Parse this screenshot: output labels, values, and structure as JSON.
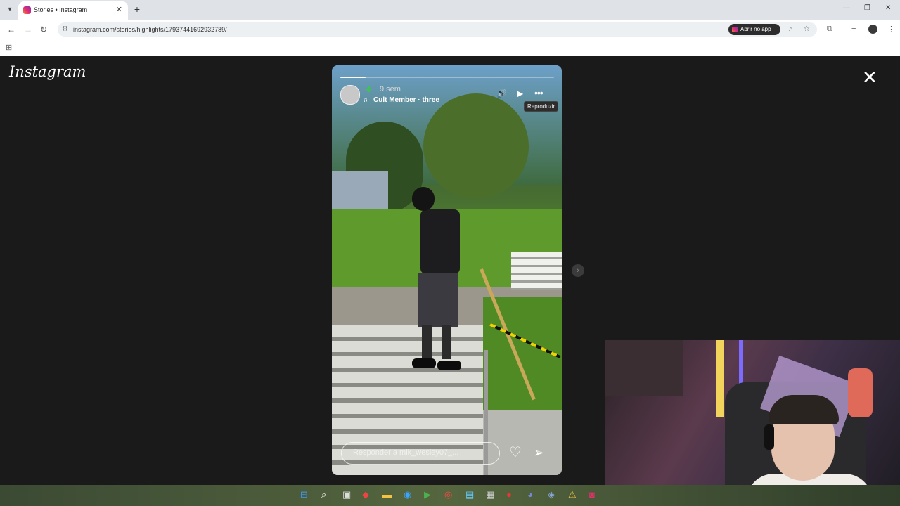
{
  "browser": {
    "tab_title": "Stories • Instagram",
    "tab_close": "✕",
    "new_tab": "+",
    "url": "instagram.com/stories/highlights/17937441692932789/",
    "open_app_label": "Abrir no app",
    "window_controls": {
      "minimize": "—",
      "restore": "❐",
      "close": "✕"
    }
  },
  "instagram": {
    "logo": "Instagram",
    "close": "✕",
    "story": {
      "progress": 0.12,
      "time_ago": "9 sem",
      "music": "Cult Member · three",
      "tooltip": "Reproduzir",
      "reply_placeholder": "Responder a mlk_wesley07_..."
    },
    "next": "›"
  },
  "taskbar": {
    "icons": [
      "windows-start-icon",
      "search-icon",
      "task-view-icon",
      "app-icon",
      "file-explorer-icon",
      "edge-icon",
      "terminal-icon",
      "chrome-icon",
      "notepad-icon",
      "calculator-icon",
      "app-icon",
      "discord-icon",
      "app-icon",
      "warning-icon",
      "instagram-icon"
    ]
  }
}
